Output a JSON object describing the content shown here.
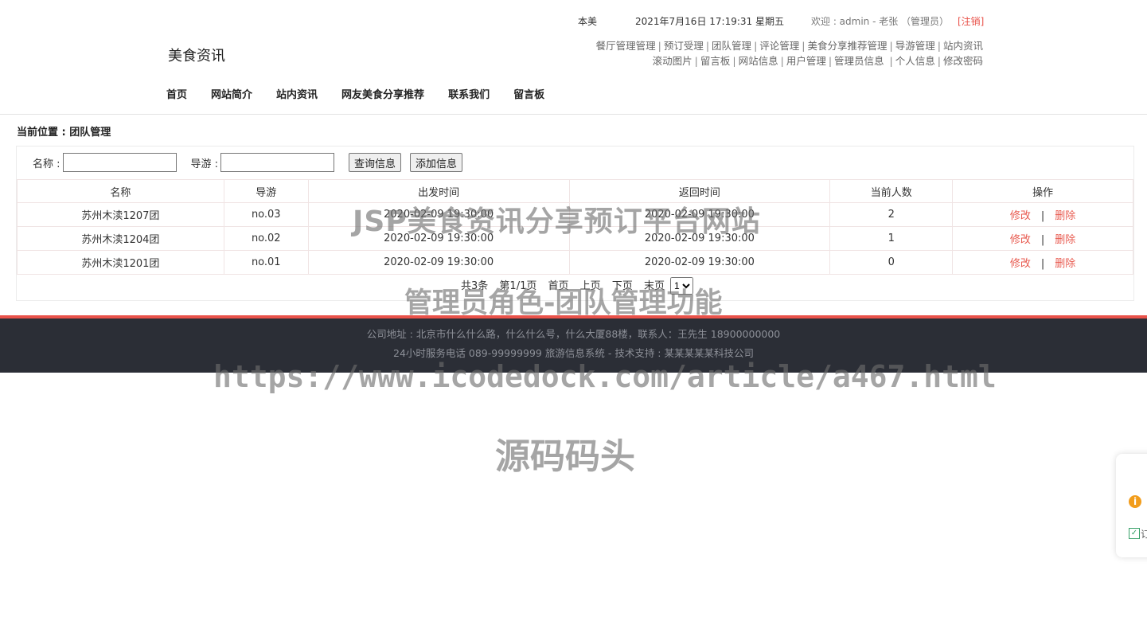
{
  "header": {
    "top_note": "本美",
    "datetime": "2021年7月16日  17:19:31  星期五",
    "welcome": "欢迎 : admin - 老张 （管理员）",
    "logout": "[注销]",
    "site_title": "美食资讯",
    "admin_links_row1": [
      "餐厅管理管理",
      "预订受理",
      "团队管理",
      "评论管理",
      "美食分享推荐管理",
      "导游管理",
      "站内资讯"
    ],
    "admin_links_row2": [
      "滚动图片",
      "留言板",
      "网站信息",
      "用户管理",
      "管理员信息",
      "个人信息",
      "修改密码"
    ],
    "nav": [
      "首页",
      "网站简介",
      "站内资讯",
      "网友美食分享推荐",
      "联系我们",
      "留言板"
    ]
  },
  "breadcrumb": "当前位置 : 团队管理",
  "search": {
    "name_label": "名称 :",
    "guide_label": "导游 :",
    "name_value": "",
    "guide_value": "",
    "query_button": "查询信息",
    "add_button": "添加信息"
  },
  "table": {
    "columns": [
      "名称",
      "导游",
      "出发时间",
      "返回时间",
      "当前人数",
      "操作"
    ],
    "rows": [
      {
        "name": "苏州木渎1207团",
        "guide": "no.03",
        "depart": "2020-02-09 19:30:00",
        "return": "2020-02-09 19:30:00",
        "count": "2"
      },
      {
        "name": "苏州木渎1204团",
        "guide": "no.02",
        "depart": "2020-02-09 19:30:00",
        "return": "2020-02-09 19:30:00",
        "count": "1"
      },
      {
        "name": "苏州木渎1201团",
        "guide": "no.01",
        "depart": "2020-02-09 19:30:00",
        "return": "2020-02-09 19:30:00",
        "count": "0"
      }
    ],
    "edit_label": "修改",
    "delete_label": "删除",
    "separator": "|"
  },
  "pager": {
    "total": "共3条",
    "page_info": "第1/1页",
    "first": "首页",
    "prev": "上页",
    "next": "下页",
    "last": "末页",
    "current_page": "1"
  },
  "footer": {
    "line1": "公司地址 : 北京市什么什么路，什么什么号，什么大厦88楼，联系人：王先生 18900000000",
    "line2": "24小时服务电话   089-99999999   旅游信息系统 - 技术支持 : 某某某某某科技公司"
  },
  "watermarks": {
    "title": "JSP美食资讯分享预订平台网站",
    "subtitle": "管理员角色-团队管理功能",
    "url": "https://www.icodedock.com/article/a467.html",
    "brand": "源码码头"
  },
  "side_widget": {
    "info_icon": "info-icon",
    "check_icon": "checkbox-icon",
    "text": "订"
  },
  "colors": {
    "accent_red": "#e9524a",
    "link_red": "#e85a4f",
    "footer_bg": "#2b2e36"
  }
}
